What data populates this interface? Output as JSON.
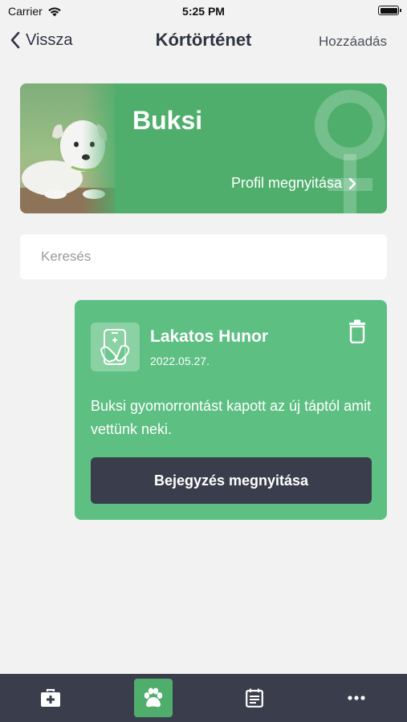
{
  "status_bar": {
    "carrier": "Carrier",
    "time": "5:25 PM"
  },
  "nav": {
    "back_label": "Vissza",
    "title": "Kórtörténet",
    "add_label": "Hozzáadás"
  },
  "pet": {
    "name": "Buksi",
    "profile_link": "Profil megnyitása",
    "gender_icon": "female-symbol-icon"
  },
  "search": {
    "placeholder": "Keresés",
    "value": ""
  },
  "entry": {
    "author": "Lakatos Hunor",
    "date": "2022.05.27.",
    "text": "Buksi gyomorrontást kapott az új táptól amit vettünk neki.",
    "button_label": "Bejegyzés megnyitása"
  },
  "tabbar": {
    "items": [
      {
        "icon": "medical-kit-icon",
        "active": false
      },
      {
        "icon": "paw-icon",
        "active": true
      },
      {
        "icon": "calendar-icon",
        "active": false
      },
      {
        "icon": "more-icon",
        "active": false
      }
    ]
  },
  "colors": {
    "brand_green": "#4fae6c",
    "card_green": "#5dbf82",
    "dark": "#3a3e4c",
    "background": "#f2f2f2"
  }
}
